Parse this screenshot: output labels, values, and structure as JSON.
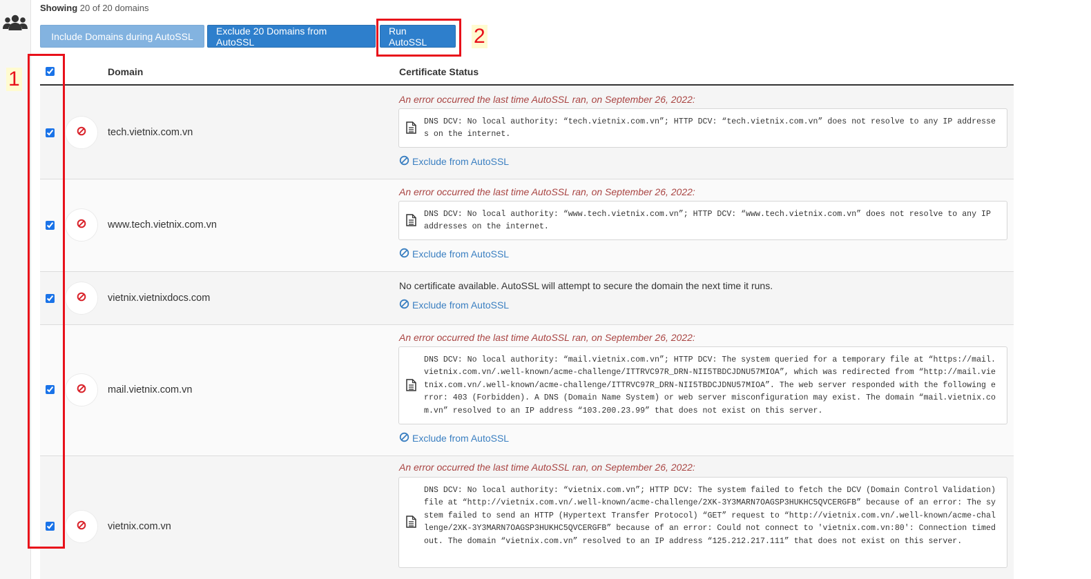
{
  "summary": {
    "showing_label": "Showing",
    "showing_text": "20 of 20 domains"
  },
  "toolbar": {
    "include_label": "Include Domains during AutoSSL",
    "exclude_label": "Exclude 20 Domains from AutoSSL",
    "run_label": "Run AutoSSL"
  },
  "annotations": {
    "marker1": "1",
    "marker2": "2",
    "color": "#e8101a"
  },
  "table": {
    "col_domain": "Domain",
    "col_status": "Certificate Status",
    "rows": [
      {
        "domain": "tech.vietnix.com.vn",
        "checked": true,
        "error_title": "An error occurred the last time AutoSSL ran, on September 26, 2022:",
        "error_text": "DNS DCV: No local authority: “tech.vietnix.com.vn”; HTTP DCV: “tech.vietnix.com.vn” does not resolve to any IP addresses on the internet.",
        "exclude_label": "Exclude from AutoSSL"
      },
      {
        "domain": "www.tech.vietnix.com.vn",
        "checked": true,
        "error_title": "An error occurred the last time AutoSSL ran, on September 26, 2022:",
        "error_text": "DNS DCV: No local authority: “www.tech.vietnix.com.vn”; HTTP DCV: “www.tech.vietnix.com.vn” does not resolve to any IP addresses on the internet.",
        "exclude_label": "Exclude from AutoSSL"
      },
      {
        "domain": "vietnix.vietnixdocs.com",
        "checked": true,
        "status_text": "No certificate available. AutoSSL will attempt to secure the domain the next time it runs.",
        "exclude_label": "Exclude from AutoSSL"
      },
      {
        "domain": "mail.vietnix.com.vn",
        "checked": true,
        "error_title": "An error occurred the last time AutoSSL ran, on September 26, 2022:",
        "error_text": "DNS DCV: No local authority: “mail.vietnix.com.vn”; HTTP DCV: The system queried for a temporary file at “https://mail.vietnix.com.vn/.well-known/acme-challenge/ITTRVC97R_DRN-NII5TBDCJDNU57MIOA”, which was redirected from “http://mail.vietnix.com.vn/.well-known/acme-challenge/ITTRVC97R_DRN-NII5TBDCJDNU57MIOA”. The web server responded with the following error: 403 (Forbidden). A DNS (Domain Name System) or web server misconfiguration may exist. The domain “mail.vietnix.com.vn” resolved to an IP address “103.200.23.99” that does not exist on this server.",
        "exclude_label": "Exclude from AutoSSL"
      },
      {
        "domain": "vietnix.com.vn",
        "checked": true,
        "error_title": "An error occurred the last time AutoSSL ran, on September 26, 2022:",
        "error_text": "DNS DCV: No local authority: “vietnix.com.vn”; HTTP DCV: The system failed to fetch the DCV (Domain Control Validation) file at “http://vietnix.com.vn/.well-known/acme-challenge/2XK-3Y3MARN7OAGSP3HUKHC5QVCERGFB” because of an error: The system failed to send an HTTP (Hypertext Transfer Protocol) “GET” request to “http://vietnix.com.vn/.well-known/acme-challenge/2XK-3Y3MARN7OAGSP3HUKHC5QVCERGFB” because of an error: Could not connect to 'vietnix.com.vn:80': Connection timed out. The domain “vietnix.com.vn” resolved to an IP address “125.212.217.111” that does not exist on this server."
      }
    ]
  }
}
